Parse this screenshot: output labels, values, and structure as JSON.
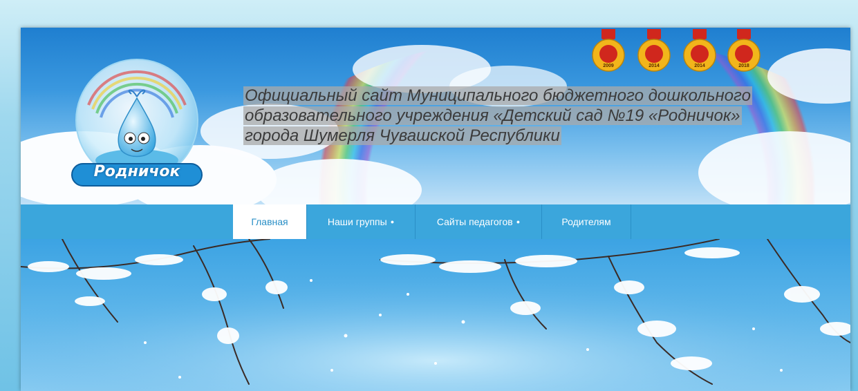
{
  "header": {
    "logo_text": "Родничок",
    "site_title_lines": [
      "Официальный сайт Муниципального бюджетного дошкольного",
      "образовательного учреждения «Детский сад №19 «Родничок»",
      "города Шумерля Чувашской Республики"
    ],
    "medals": [
      {
        "year": "2009",
        "icon": "award-medal-icon"
      },
      {
        "year": "2014",
        "icon": "award-medal-icon"
      },
      {
        "year": "2014",
        "icon": "award-medal-icon"
      },
      {
        "year": "2018",
        "icon": "award-medal-icon"
      }
    ]
  },
  "nav": {
    "items": [
      {
        "label": "Главная",
        "active": true,
        "has_submenu": false
      },
      {
        "label": "Наши группы",
        "active": false,
        "has_submenu": true
      },
      {
        "label": "Сайты педагогов",
        "active": false,
        "has_submenu": true
      },
      {
        "label": "Родителям",
        "active": false,
        "has_submenu": false
      }
    ],
    "submenu_marker": "●"
  },
  "colors": {
    "nav_bg": "#3ba6dc",
    "nav_active_bg": "#ffffff",
    "nav_active_text": "#2a8fc6",
    "medal_gold": "#f2b51b",
    "medal_red": "#d0271d"
  }
}
